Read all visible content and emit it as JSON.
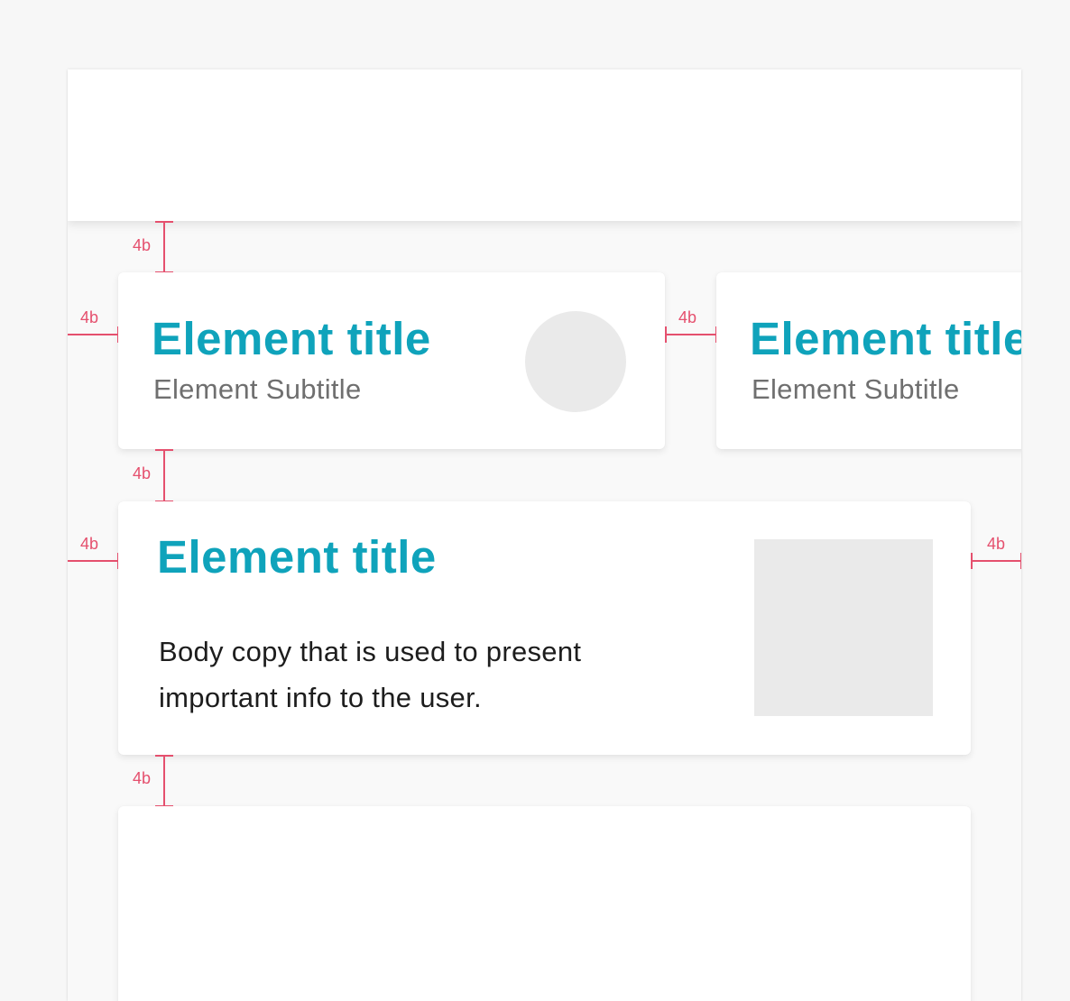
{
  "colors": {
    "page_background": "#f7f7f7",
    "title": "#0fa3bb",
    "subtitle": "#6f6f6f",
    "body": "#1d1d1d",
    "placeholder": "#eaeaea",
    "annotation": "#e5506e"
  },
  "spacing_label": "4b",
  "cards": {
    "small_left": {
      "title": "Element title",
      "subtitle": "Element Subtitle"
    },
    "small_right": {
      "title": "Element title",
      "subtitle": "Element Subtitle"
    },
    "wide": {
      "title": "Element title",
      "body_line_1": "Body copy that is used to present",
      "body_line_2": "important info to the user."
    }
  }
}
